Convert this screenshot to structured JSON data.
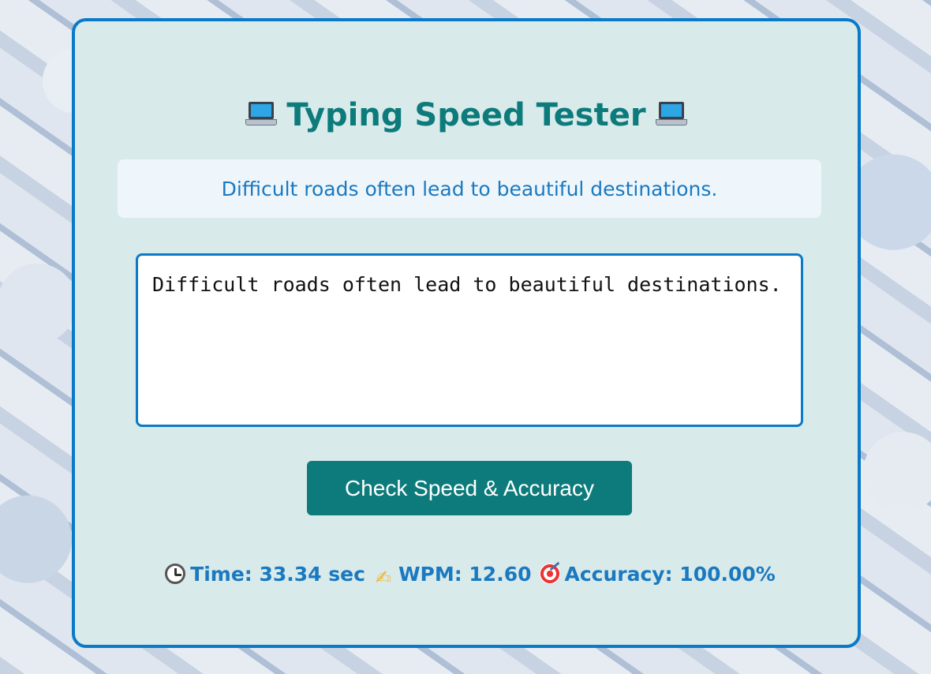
{
  "app": {
    "title": "Typing Speed Tester",
    "title_icon": "laptop-icon"
  },
  "quote": {
    "text": "Difficult roads often lead to beautiful destinations."
  },
  "typing_area": {
    "value": "Difficult roads often lead to beautiful destinations."
  },
  "actions": {
    "check_label": "Check Speed & Accuracy"
  },
  "results": {
    "time_icon": "clock-icon",
    "time": "Time: 33.34 sec",
    "wpm_icon": "writing-hand-icon",
    "wpm": "WPM: 12.60",
    "accuracy_icon": "target-icon",
    "accuracy": "Accuracy: 100.00%"
  },
  "colors": {
    "accent": "#0a7ac8",
    "title": "#0d7b7b",
    "button": "#0d7b7b",
    "card_bg": "#d8eaea",
    "quote_bg": "#eef6fb",
    "result_text": "#1a79c0"
  }
}
